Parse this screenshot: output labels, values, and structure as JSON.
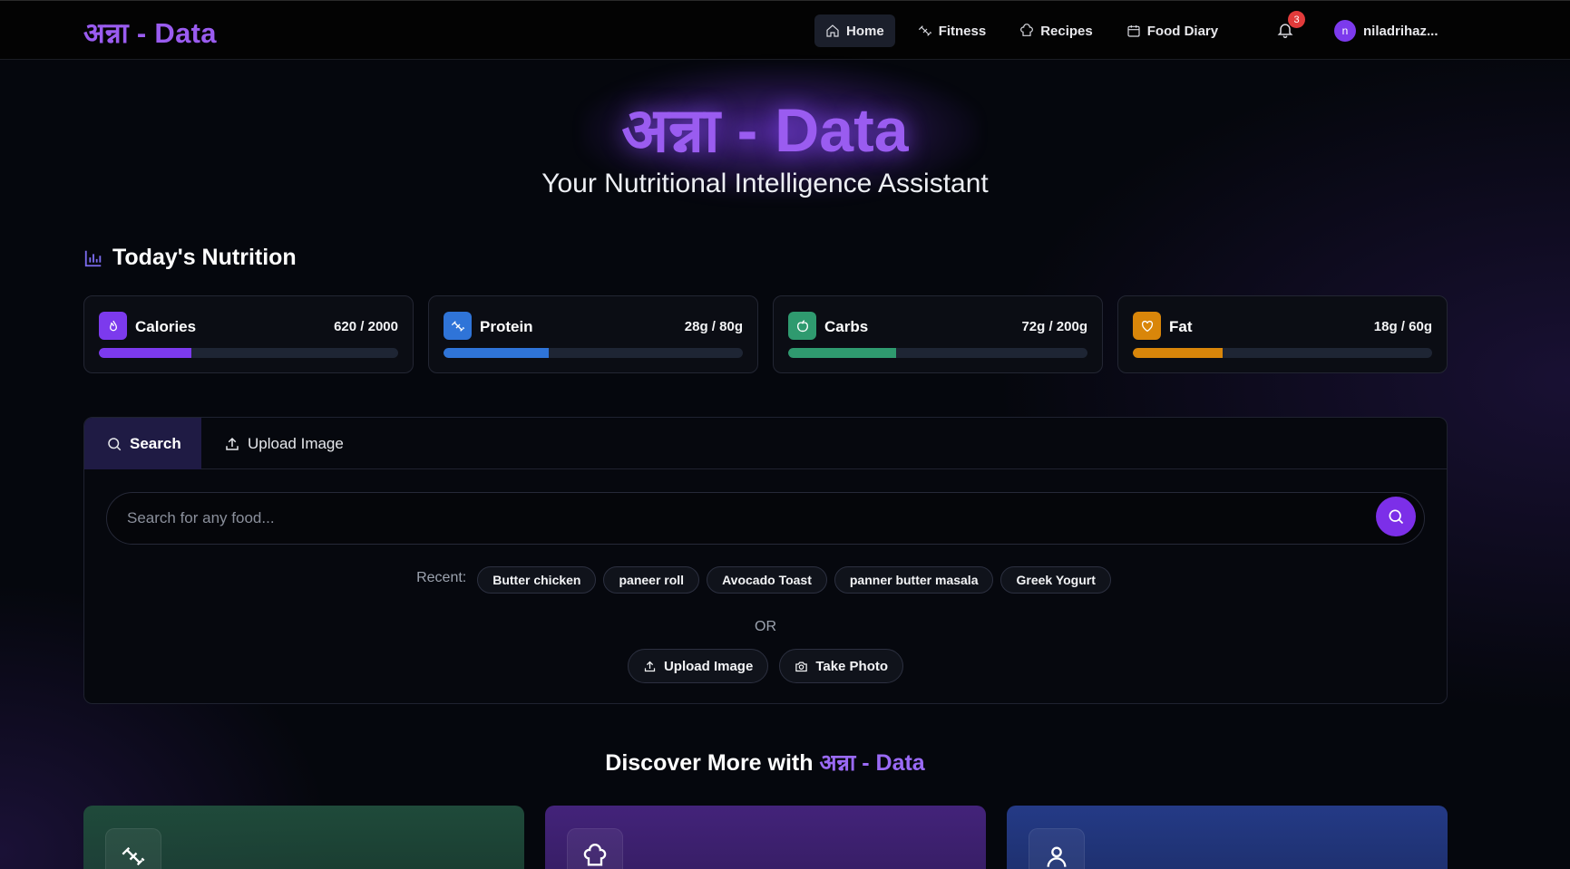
{
  "app": {
    "logo": "अन्ना - Data"
  },
  "nav": {
    "items": [
      {
        "label": "Home",
        "icon": "home-icon",
        "active": true
      },
      {
        "label": "Fitness",
        "icon": "dumbbell-icon",
        "active": false
      },
      {
        "label": "Recipes",
        "icon": "chef-hat-icon",
        "active": false
      },
      {
        "label": "Food Diary",
        "icon": "calendar-icon",
        "active": false
      }
    ],
    "notifications_count": "3",
    "user": {
      "initial": "n",
      "name": "niladrihaz..."
    }
  },
  "hero": {
    "title": "अन्ना - Data",
    "subtitle": "Your Nutritional Intelligence Assistant"
  },
  "nutrition": {
    "title": "Today's Nutrition",
    "cards": [
      {
        "name": "Calories",
        "value": "620 / 2000",
        "progress": 0.31,
        "color": "#7c3aed",
        "icon": "flame-icon"
      },
      {
        "name": "Protein",
        "value": "28g / 80g",
        "progress": 0.35,
        "color": "#2f74d8",
        "icon": "dumbbell-icon"
      },
      {
        "name": "Carbs",
        "value": "72g / 200g",
        "progress": 0.36,
        "color": "#2f9a6f",
        "icon": "apple-icon"
      },
      {
        "name": "Fat",
        "value": "18g / 60g",
        "progress": 0.3,
        "color": "#d9860a",
        "icon": "heart-icon"
      }
    ]
  },
  "search": {
    "tabs": [
      {
        "label": "Search",
        "active": true
      },
      {
        "label": "Upload Image",
        "active": false
      }
    ],
    "placeholder": "Search for any food...",
    "recent_label": "Recent:",
    "recent": [
      "Butter chicken",
      "paneer roll",
      "Avocado Toast",
      "panner butter masala",
      "Greek Yogurt"
    ],
    "or_label": "OR",
    "upload_label": "Upload Image",
    "photo_label": "Take Photo"
  },
  "discover": {
    "title_prefix": "Discover More with",
    "title_accent": "अन्ना - Data",
    "cards": [
      {
        "icon": "dumbbell-icon",
        "color": "#1f4a3a"
      },
      {
        "icon": "chef-hat-icon",
        "color": "#43237a"
      },
      {
        "icon": "user-icon",
        "color": "#243a86"
      }
    ]
  }
}
